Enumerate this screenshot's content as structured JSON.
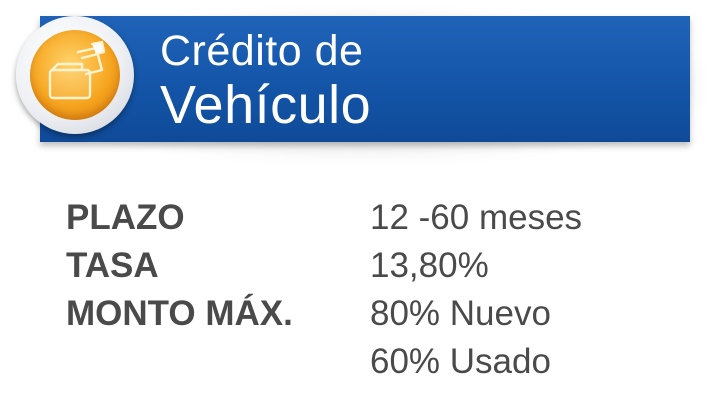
{
  "banner": {
    "title_line1": "Crédito de",
    "title_line2": "Vehículo",
    "background_color": "#1455a8",
    "badge_color": "#f6a51f"
  },
  "details": [
    {
      "label": "PLAZO",
      "values": [
        "12 -60 meses"
      ]
    },
    {
      "label": "TASA",
      "values": [
        "13,80%"
      ]
    },
    {
      "label": "MONTO MÁX.",
      "values": [
        "80% Nuevo",
        "60% Usado"
      ]
    }
  ]
}
